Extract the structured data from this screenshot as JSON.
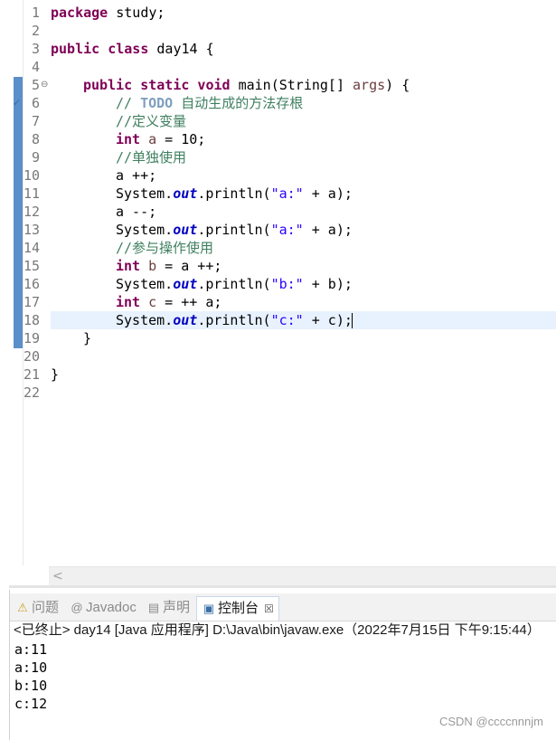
{
  "editor": {
    "line_numbers": [
      "1",
      "2",
      "3",
      "4",
      "5",
      "6",
      "7",
      "8",
      "9",
      "10",
      "11",
      "12",
      "13",
      "14",
      "15",
      "16",
      "17",
      "18",
      "19",
      "20",
      "21",
      "22"
    ],
    "lines": {
      "l1_kw": "package",
      "l1_rest": " study;",
      "l3_kw": "public class",
      "l3_rest": " day14 {",
      "l5_kw1": "public static void",
      "l5_mid": " main(String[] ",
      "l5_prm": "args",
      "l5_end": ") {",
      "l6_cm1": "// ",
      "l6_todo": "TODO",
      "l6_cm2": " 自动生成的方法存根",
      "l7_cm": "//定义变量",
      "l8_kw": "int",
      "l8_var": " a",
      "l8_rest": " = 10;",
      "l9_cm": "//单独使用",
      "l10": "a ++;",
      "l11_a": "System.",
      "l11_fld": "out",
      "l11_b": ".println(",
      "l11_str": "\"a:\"",
      "l11_c": " + a);",
      "l12": "a --;",
      "l13_a": "System.",
      "l13_fld": "out",
      "l13_b": ".println(",
      "l13_str": "\"a:\"",
      "l13_c": " + a);",
      "l14_cm": "//参与操作使用",
      "l15_kw": "int",
      "l15_var": " b",
      "l15_rest": " = a ++;",
      "l16_a": "System.",
      "l16_fld": "out",
      "l16_b": ".println(",
      "l16_str": "\"b:\"",
      "l16_c": " + b);",
      "l17_kw": "int",
      "l17_var": " c",
      "l17_rest": " = ++ a;",
      "l18_a": "System.",
      "l18_fld": "out",
      "l18_b": ".println(",
      "l18_str": "\"c:\"",
      "l18_c": " + c);",
      "l19": "}",
      "l21": "}"
    },
    "collapse_glyph": "⊖",
    "todo_glyph": "✓",
    "scroll_left_glyph": "<"
  },
  "panel": {
    "tabs": {
      "problems": "问题",
      "javadoc": "Javadoc",
      "declaration": "声明",
      "console": "控制台",
      "close_glyph": "☒"
    },
    "icons": {
      "problems": "⚠",
      "javadoc": "@",
      "declaration": "▤",
      "console": "▣"
    },
    "console_header": "<已终止> day14 [Java 应用程序] D:\\Java\\bin\\javaw.exe（2022年7月15日 下午9:15:44）",
    "output": [
      "a:11",
      "a:10",
      "b:10",
      "c:12"
    ]
  },
  "watermark": "CSDN @ccccnnnjm",
  "colors": {
    "keyword": "#7f0055",
    "comment": "#3f7f5f",
    "string": "#2a00ff",
    "field": "#0000c0",
    "current_line": "#e8f2fe"
  }
}
